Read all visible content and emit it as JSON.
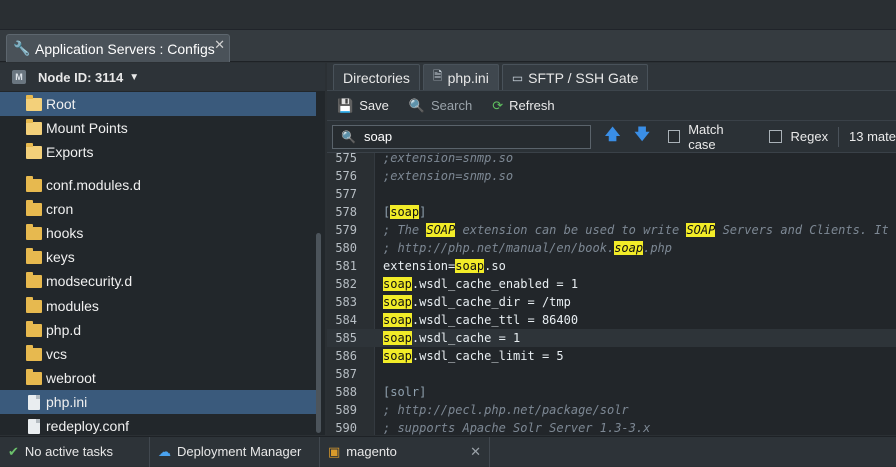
{
  "window_tab": {
    "title": "Application Servers : Configs",
    "close": "✕"
  },
  "node": {
    "label": "Node ID: 3114"
  },
  "tree": [
    {
      "label": "Root",
      "type": "folder-open",
      "selected": true
    },
    {
      "label": "Mount Points",
      "type": "folder-open"
    },
    {
      "label": "Exports",
      "type": "folder-open"
    },
    {
      "label": "conf.modules.d",
      "type": "folder"
    },
    {
      "label": "cron",
      "type": "folder"
    },
    {
      "label": "hooks",
      "type": "folder"
    },
    {
      "label": "keys",
      "type": "folder"
    },
    {
      "label": "modsecurity.d",
      "type": "folder"
    },
    {
      "label": "modules",
      "type": "folder"
    },
    {
      "label": "php.d",
      "type": "folder"
    },
    {
      "label": "vcs",
      "type": "folder"
    },
    {
      "label": "webroot",
      "type": "folder"
    },
    {
      "label": "php.ini",
      "type": "file",
      "selected": true
    },
    {
      "label": "redeploy.conf",
      "type": "file"
    }
  ],
  "tabs": [
    {
      "label": "Directories"
    },
    {
      "label": "php.ini",
      "active": true
    },
    {
      "label": "SFTP / SSH Gate"
    }
  ],
  "toolbar": {
    "save": "Save",
    "search": "Search",
    "refresh": "Refresh"
  },
  "search": {
    "value": "soap",
    "match_case": "Match case",
    "regex": "Regex",
    "count": "13 mate"
  },
  "code_lines": [
    {
      "n": "575",
      "html": "<span class='cm'>;extension=snmp.so</span>"
    },
    {
      "n": "576",
      "html": "<span class='cm'>;extension=snmp.so</span>"
    },
    {
      "n": "577",
      "html": ""
    },
    {
      "n": "578",
      "html": "<span class='sec'>[<span class='hl'>soap</span>]</span>"
    },
    {
      "n": "579",
      "html": "<span class='cm'>; The <span class='hl'>SOAP</span> extension can be used to write <span class='hl'>SOAP</span> Servers and Clients. It supports</span>"
    },
    {
      "n": "580",
      "html": "<span class='cm'>; http://php.net/manual/en/book.<span class='hl'>soap</span>.php</span>"
    },
    {
      "n": "581",
      "html": "<span class='kw'>extension=<span class='hl'>soap</span>.so</span>"
    },
    {
      "n": "582",
      "html": "<span class='kw'><span class='hl'>soap</span>.wsdl_cache_enabled = 1</span>"
    },
    {
      "n": "583",
      "html": "<span class='kw'><span class='hl'>soap</span>.wsdl_cache_dir = /tmp</span>"
    },
    {
      "n": "584",
      "html": "<span class='kw'><span class='hl'>soap</span>.wsdl_cache_ttl = 86400</span>"
    },
    {
      "n": "585",
      "html": "<span class='kw'><span class='hl'>soap</span>.wsdl_cache = 1</span>",
      "current": true
    },
    {
      "n": "586",
      "html": "<span class='kw'><span class='hl'>soap</span>.wsdl_cache_limit = 5</span>"
    },
    {
      "n": "587",
      "html": ""
    },
    {
      "n": "588",
      "html": "<span class='sec'>[solr]</span>"
    },
    {
      "n": "589",
      "html": "<span class='cm'>; http://pecl.php.net/package/solr</span>"
    },
    {
      "n": "590",
      "html": "<span class='cm'>; supports Apache Solr Server 1.3-3.x</span>"
    }
  ],
  "status": {
    "tasks": "No active tasks",
    "deploy": "Deployment Manager",
    "env": "magento"
  },
  "colors": {
    "highlight": "#f2ec28",
    "accent": "#3a8ee6",
    "selection": "#3a5a7c"
  }
}
